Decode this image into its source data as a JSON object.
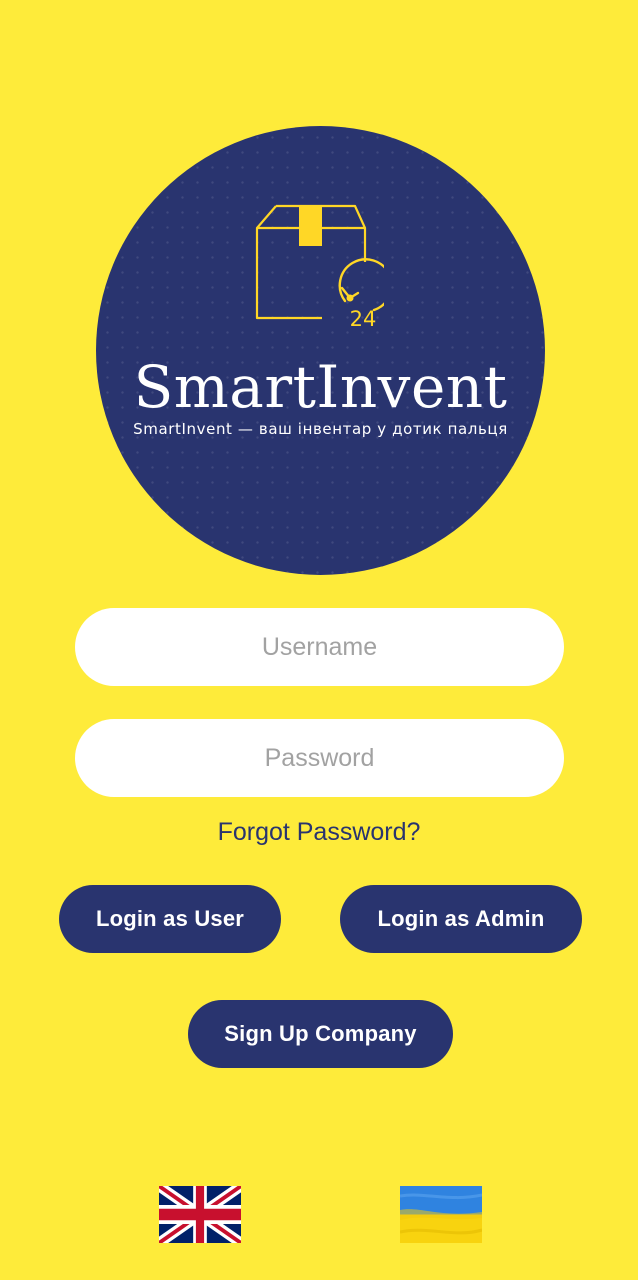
{
  "logo": {
    "brand_name": "SmartInvent",
    "tagline": "SmartInvent — ваш інвентар у дотик пальця",
    "badge_text": "24",
    "icon": "box-clock-icon"
  },
  "login_form": {
    "username_placeholder": "Username",
    "password_placeholder": "Password",
    "forgot_password_label": "Forgot Password?"
  },
  "actions": {
    "login_user_label": "Login as User",
    "login_admin_label": "Login as Admin",
    "signup_company_label": "Sign Up Company"
  },
  "languages": [
    {
      "code": "en",
      "icon": "uk-flag-icon"
    },
    {
      "code": "uk",
      "icon": "ukraine-flag-icon"
    }
  ],
  "colors": {
    "background": "#FEEB3A",
    "primary": "#29346F",
    "accent": "#FFD726",
    "field_background": "#FFFFFF",
    "placeholder": "#A2A2A2"
  }
}
